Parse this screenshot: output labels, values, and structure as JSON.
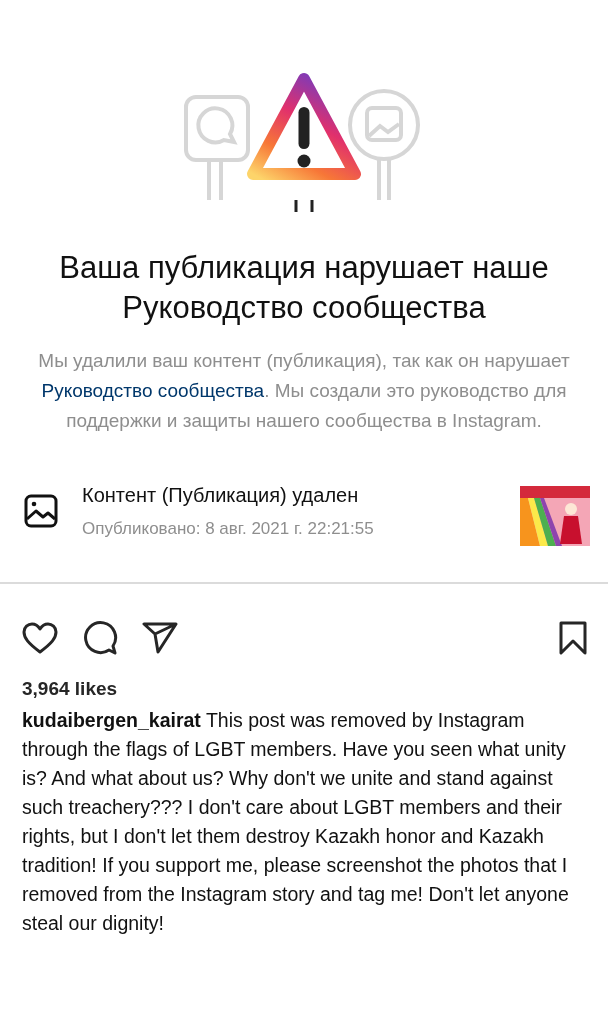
{
  "notice": {
    "title": "Ваша публикация нарушает наше Руководство сообщества",
    "message_before": "Мы удалили ваш контент (публикация), так как он нарушает ",
    "message_link": "Руководство сообщества",
    "message_after": ". Мы создали это руководство для поддержки и защиты нашего сообщества в Instagram."
  },
  "content_item": {
    "title": "Контент (Публикация) удален",
    "published": "Опубликовано: 8 авг. 2021 г. 22:21:55"
  },
  "post": {
    "likes": "3,964 likes",
    "caption": "**kudaibergen_kairat** This post was removed by Instagram through the flags of LGBT members. Have you seen what unity is? And what about us? Why don't we unite and stand against such treachery??? I don't care about LGBT members and their rights, but I don't let them destroy Kazakh honor and Kazakh tradition! If you support me, please screenshot the photos that I removed from the Instagram story and tag me! Don't let anyone steal our dignity!"
  }
}
